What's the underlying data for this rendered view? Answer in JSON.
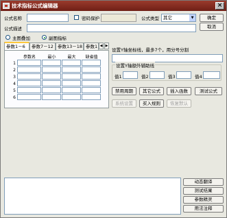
{
  "window": {
    "title": "技术指标公式编辑器",
    "close_glyph": "×"
  },
  "form": {
    "name_label": "公式名称",
    "name_value": "",
    "password_label": "密码保护",
    "password_checked": false,
    "type_label": "公式类型",
    "type_value": "其它",
    "desc_label": "公式描述",
    "desc_value": "",
    "ok_label": "确定",
    "cancel_label": "取消"
  },
  "chart_mode": {
    "options": [
      "主图叠加",
      "副图指标"
    ],
    "selected": "副图指标"
  },
  "tabs": {
    "items": [
      "参数1－6",
      "参数7－12",
      "参数13－18",
      "参数1"
    ],
    "active_index": 0,
    "prev_glyph": "◀",
    "next_glyph": "▶"
  },
  "param_grid": {
    "headers": [
      "参数名",
      "最小",
      "最大",
      "缺省值"
    ],
    "rows": [
      "1",
      "2",
      "3",
      "4",
      "5",
      "6"
    ]
  },
  "settings": {
    "hint_label": "设置Y轴坐标线，最多7个，用分号分割",
    "hint_value": "",
    "aux_legend": "设置Y轴额外辅助线",
    "aux_labels": [
      "值1",
      "值2",
      "值3",
      "值4"
    ]
  },
  "actions": {
    "row1": [
      "禁用周期",
      "其它公式",
      "插入函数",
      "测试公式"
    ],
    "row2": [
      "系统设置",
      "买入规则",
      "恢复默认"
    ],
    "row2_disabled": [
      true,
      false,
      true
    ]
  },
  "side_buttons": [
    "动态翻译",
    "测试结果",
    "参数精灵",
    "用法注释"
  ]
}
